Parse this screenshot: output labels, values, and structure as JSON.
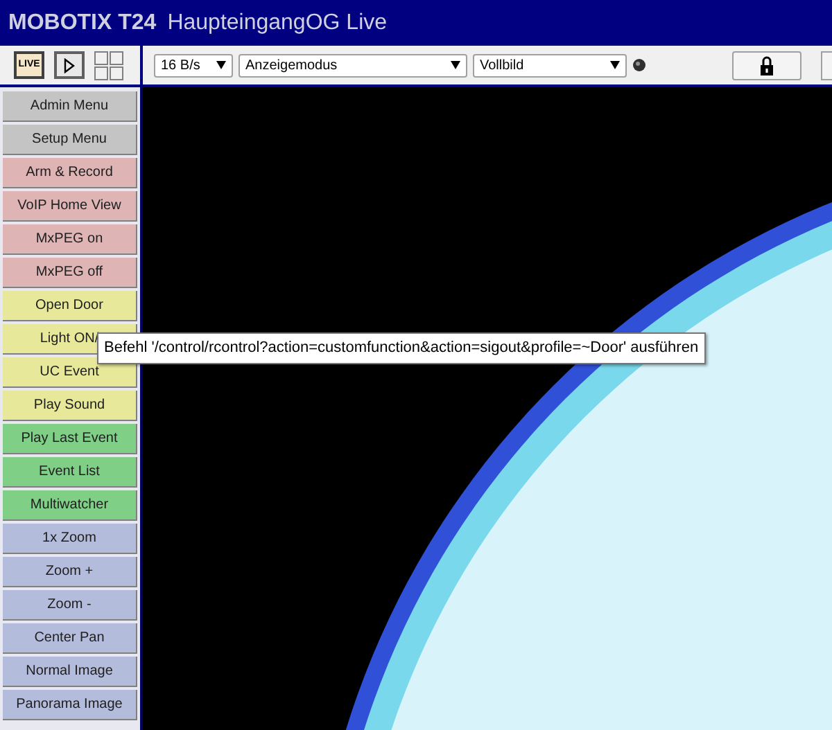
{
  "title_bar": {
    "brand": "MOBOTIX T24",
    "title": "HaupteingangOG Live"
  },
  "toolbar": {
    "live_button": {
      "label": "LIVE",
      "selected": true
    },
    "frame_rate": {
      "value": "16 B/s"
    },
    "display_mode": {
      "value": "Anzeigemodus"
    },
    "view": {
      "value": "Vollbild"
    }
  },
  "sidebar": {
    "items": [
      {
        "label": "Admin Menu",
        "color": "#c4c4c4"
      },
      {
        "label": "Setup Menu",
        "color": "#c4c4c4"
      },
      {
        "label": "Arm & Record",
        "color": "#dfb4b4"
      },
      {
        "label": "VoIP Home View",
        "color": "#dfb4b4"
      },
      {
        "label": "MxPEG on",
        "color": "#dfb4b4"
      },
      {
        "label": "MxPEG off",
        "color": "#dfb4b4"
      },
      {
        "label": "Open Door",
        "color": "#e8e89a"
      },
      {
        "label": "Light ON/",
        "color": "#e8e89a"
      },
      {
        "label": "UC Event",
        "color": "#e8e89a"
      },
      {
        "label": "Play Sound",
        "color": "#e8e89a"
      },
      {
        "label": "Play Last Event",
        "color": "#7fcf86"
      },
      {
        "label": "Event List",
        "color": "#7fcf86"
      },
      {
        "label": "Multiwatcher",
        "color": "#7fcf86"
      },
      {
        "label": "1x Zoom",
        "color": "#b4bcdc"
      },
      {
        "label": "Zoom +",
        "color": "#b4bcdc"
      },
      {
        "label": "Zoom -",
        "color": "#b4bcdc"
      },
      {
        "label": "Center Pan",
        "color": "#b4bcdc"
      },
      {
        "label": "Normal Image",
        "color": "#b4bcdc"
      },
      {
        "label": "Panorama Image",
        "color": "#b4bcdc"
      }
    ]
  },
  "tooltip": {
    "text": "Befehl '/control/rcontrol?action=customfunction&action=sigout&profile=~Door' ausführen"
  }
}
